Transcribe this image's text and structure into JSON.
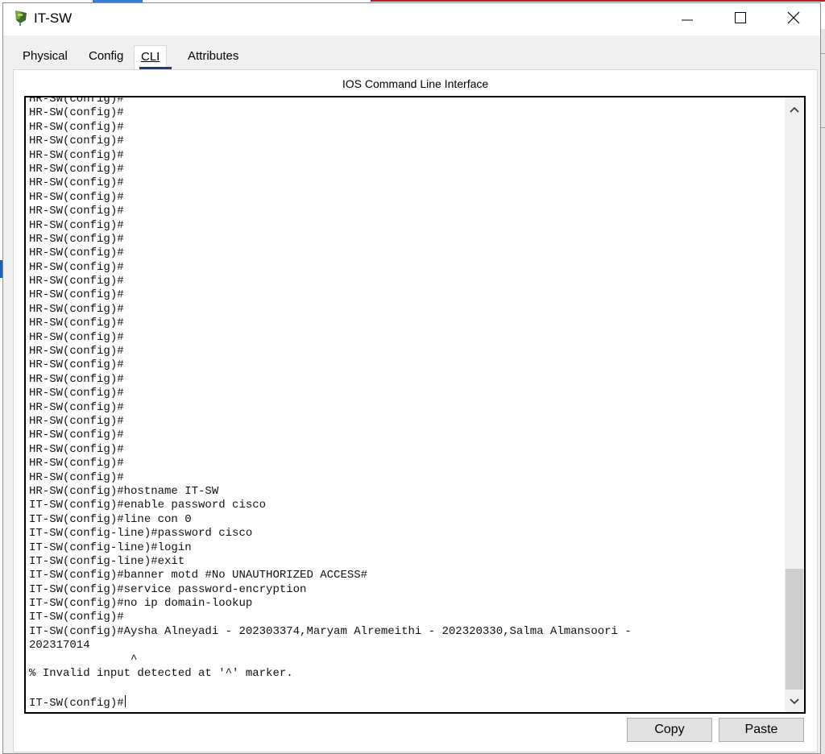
{
  "window": {
    "title": "IT-SW",
    "controls": {
      "minimize": "minimize",
      "maximize": "maximize",
      "close": "close"
    }
  },
  "tabs": [
    {
      "label": "Physical",
      "active": false
    },
    {
      "label": "Config",
      "active": false
    },
    {
      "label": "CLI",
      "active": true
    },
    {
      "label": "Attributes",
      "active": false
    }
  ],
  "cli": {
    "panel_title": "IOS Command Line Interface",
    "lines": [
      "HR-SW(config)#",
      "HR-SW(config)#",
      "HR-SW(config)#",
      "HR-SW(config)#",
      "HR-SW(config)#",
      "HR-SW(config)#",
      "HR-SW(config)#",
      "HR-SW(config)#",
      "HR-SW(config)#",
      "HR-SW(config)#",
      "HR-SW(config)#",
      "HR-SW(config)#",
      "HR-SW(config)#",
      "HR-SW(config)#",
      "HR-SW(config)#",
      "HR-SW(config)#",
      "HR-SW(config)#",
      "HR-SW(config)#",
      "HR-SW(config)#",
      "HR-SW(config)#",
      "HR-SW(config)#",
      "HR-SW(config)#",
      "HR-SW(config)#",
      "HR-SW(config)#",
      "HR-SW(config)#",
      "HR-SW(config)#",
      "HR-SW(config)#",
      "HR-SW(config)#",
      "HR-SW(config)#hostname IT-SW",
      "IT-SW(config)#enable password cisco",
      "IT-SW(config)#line con 0",
      "IT-SW(config-line)#password cisco",
      "IT-SW(config-line)#login",
      "IT-SW(config-line)#exit",
      "IT-SW(config)#banner motd #No UNAUTHORIZED ACCESS#",
      "IT-SW(config)#service password-encryption",
      "IT-SW(config)#no ip domain-lookup",
      "IT-SW(config)#",
      "IT-SW(config)#Aysha Alneyadi - 202303374,Maryam Alremeithi - 202320330,Salma Almansoori -",
      "202317014",
      "               ^",
      "% Invalid input detected at '^' marker.",
      "",
      "IT-SW(config)#"
    ]
  },
  "buttons": {
    "copy": "Copy",
    "paste": "Paste"
  }
}
